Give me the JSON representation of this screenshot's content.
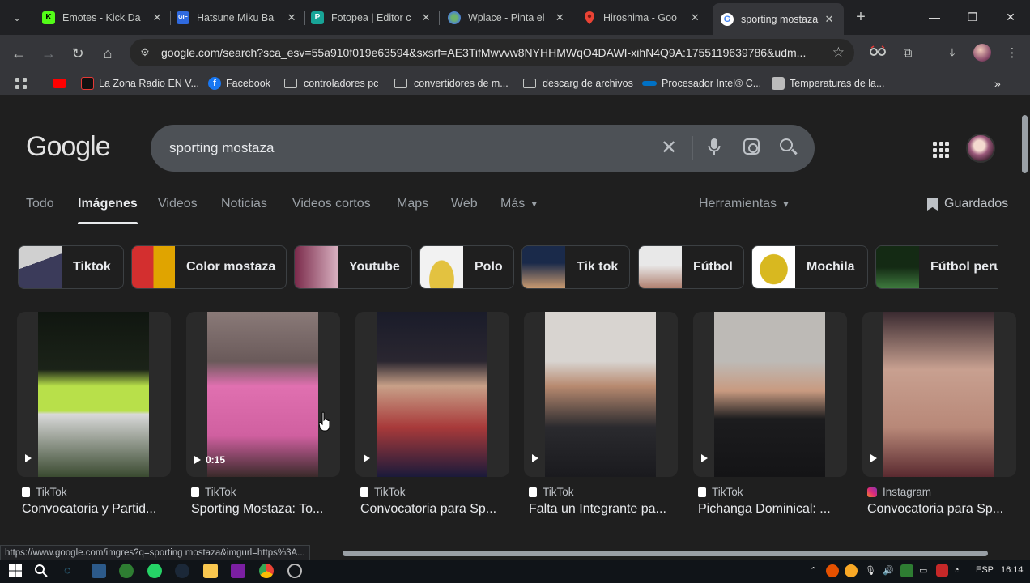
{
  "browser": {
    "tabs": [
      {
        "title": "Emotes - Kick Da",
        "favicon_color": "#53fc18",
        "favicon_glyph": "K",
        "active": false
      },
      {
        "title": "Hatsune Miku Ba",
        "favicon_color": "#2f6ae0",
        "favicon_glyph": "GIF",
        "active": false
      },
      {
        "title": "Fotopea | Editor c",
        "favicon_color": "#18a497",
        "favicon_glyph": "P",
        "active": false
      },
      {
        "title": "Wplace - Pinta el",
        "favicon_color": "#4a7fd6",
        "favicon_glyph": "globe",
        "active": false
      },
      {
        "title": "Hiroshima - Goo",
        "favicon_color": "#34a853",
        "favicon_glyph": "pin",
        "active": false
      },
      {
        "title": "sporting mostaza",
        "favicon_color": "#ffffff",
        "favicon_glyph": "G",
        "active": true
      }
    ],
    "url": "google.com/search?sca_esv=55a910f019e63594&sxsrf=AE3TifMwvvw8NYHHMWqO4DAWI-xihN4Q9A:1755119639786&udm...",
    "bookmarks": [
      {
        "label": "",
        "icon": "youtube-icon",
        "color": "#ff0000"
      },
      {
        "label": "La Zona Radio EN V...",
        "icon": "radio-icon",
        "color": "#e53935"
      },
      {
        "label": "Facebook",
        "icon": "facebook-icon",
        "color": "#1877f2"
      },
      {
        "label": "controladores pc",
        "icon": "folder-icon"
      },
      {
        "label": "convertidores de m...",
        "icon": "folder-icon"
      },
      {
        "label": "descarg de archivos",
        "icon": "folder-icon"
      },
      {
        "label": "Procesador Intel® C...",
        "icon": "intel-icon",
        "color": "#0071c5"
      },
      {
        "label": "Temperaturas de la...",
        "icon": "page-icon",
        "color": "#bbbbbb"
      }
    ],
    "status_url": "https://www.google.com/imgres?q=sporting mostaza&imgurl=https%3A..."
  },
  "google": {
    "logo": "Google",
    "query": "sporting mostaza",
    "nav": [
      "Todo",
      "Imágenes",
      "Videos",
      "Noticias",
      "Videos cortos",
      "Maps",
      "Web",
      "Más"
    ],
    "active_nav": "Imágenes",
    "more_arrow": "▾",
    "tools": "Herramientas",
    "saved": "Guardados",
    "chips": [
      {
        "label": "Tiktok",
        "c1": "#c8c8c8",
        "c2": "#3b3b5a"
      },
      {
        "label": "Color mostaza",
        "c1": "#d32f2f",
        "c2": "#e0a400"
      },
      {
        "label": "Youtube",
        "c1": "#7a2a4a",
        "c2": "#d8b0c0"
      },
      {
        "label": "Polo",
        "c1": "#f2f2f2",
        "c2": "#e3c240"
      },
      {
        "label": "Tik tok",
        "c1": "#1a2a4a",
        "c2": "#c89a70"
      },
      {
        "label": "Fútbol",
        "c1": "#e8e8e8",
        "c2": "#b08070"
      },
      {
        "label": "Mochila",
        "c1": "#ffffff",
        "c2": "#d8b820"
      },
      {
        "label": "Fútbol peru",
        "c1": "#142a14",
        "c2": "#3e7a3e"
      }
    ],
    "results": [
      {
        "source": "TikTok",
        "title": "Convocatoria y Partid...",
        "duration": "",
        "c1": "#1b2318",
        "c2": "#b8e04a",
        "src_color": "#ffffff"
      },
      {
        "source": "TikTok",
        "title": "Sporting Mostaza: To...",
        "duration": "0:15",
        "c1": "#6a5a5a",
        "c2": "#e070b0",
        "src_color": "#ffffff"
      },
      {
        "source": "TikTok",
        "title": "Convocatoria para Sp...",
        "duration": "",
        "c1": "#1a1c2a",
        "c2": "#a83a3a",
        "src_color": "#ffffff"
      },
      {
        "source": "TikTok",
        "title": "Falta un Integrante pa...",
        "duration": "",
        "c1": "#d8d4d0",
        "c2": "#2a2a2e",
        "src_color": "#ffffff"
      },
      {
        "source": "TikTok",
        "title": "Pichanga Dominical: ...",
        "duration": "",
        "c1": "#bdbab6",
        "c2": "#1c1c1e",
        "src_color": "#ffffff"
      },
      {
        "source": "Instagram",
        "title": "Convocatoria para Sp...",
        "duration": "",
        "c1": "#3a2a30",
        "c2": "#c8a090",
        "src_color": "#e1306c"
      }
    ]
  },
  "taskbar": {
    "language": "ESP",
    "time": "16:14"
  }
}
